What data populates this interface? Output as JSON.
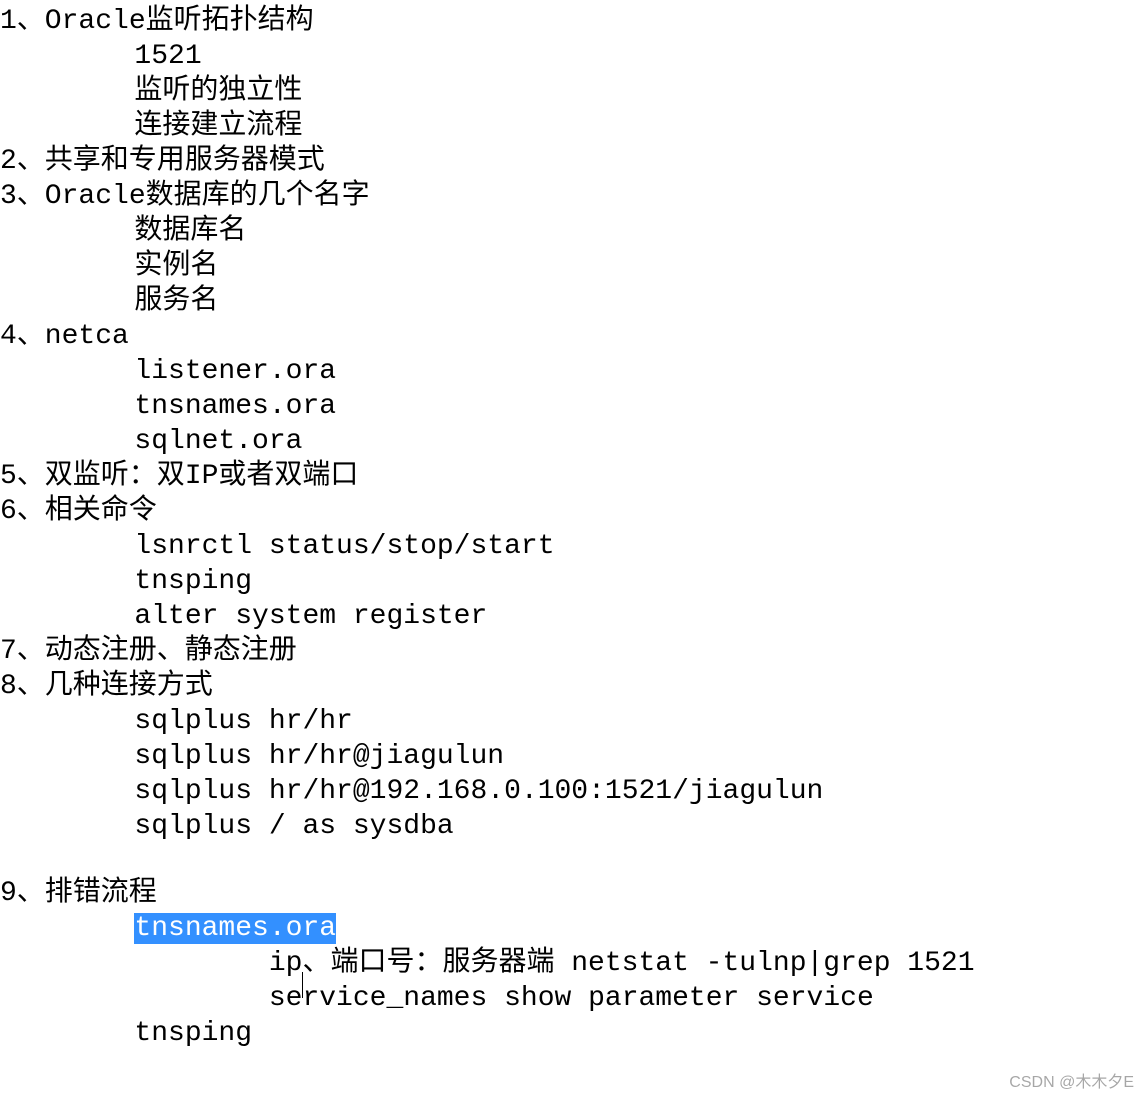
{
  "lines": {
    "l1": "1、Oracle监听拓扑结构",
    "l1a": "        1521",
    "l1b": "        监听的独立性",
    "l1c": "        连接建立流程",
    "l2": "2、共享和专用服务器模式",
    "l3": "3、Oracle数据库的几个名字",
    "l3a": "        数据库名",
    "l3b": "        实例名",
    "l3c": "        服务名",
    "l4": "4、netca",
    "l4a": "        listener.ora",
    "l4b": "        tnsnames.ora",
    "l4c": "        sqlnet.ora",
    "l5": "5、双监听：双IP或者双端口",
    "l6": "6、相关命令",
    "l6a": "        lsnrctl status/stop/start",
    "l6b": "        tnsping",
    "l6c": "        alter system register",
    "l7": "7、动态注册、静态注册",
    "l8": "8、几种连接方式",
    "l8a": "        sqlplus hr/hr",
    "l8b": "        sqlplus hr/hr@jiagulun",
    "l8c": "        sqlplus hr/hr@192.168.0.100:1521/jiagulun",
    "l8d": "        sqlplus / as sysdba",
    "l9": "9、排错流程",
    "l9a_prefix": "        ",
    "l9a_highlight": "tnsnames.ora",
    "l9b_prefix": "                ip",
    "l9b_rest": "、端口号：服务器端 netstat -tulnp|grep 1521",
    "l9c": "                service_names show parameter service",
    "l9d": "        tnsping"
  },
  "watermark": "CSDN @木木夕E"
}
